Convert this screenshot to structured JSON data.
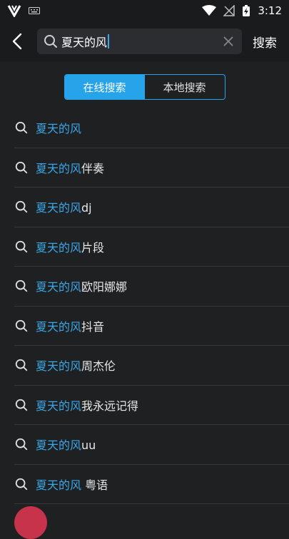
{
  "status_bar": {
    "time": "3:12",
    "icons": [
      "app-v-icon",
      "keyboard-icon",
      "wifi-icon",
      "no-signal-icon",
      "battery-charging-icon"
    ]
  },
  "header": {
    "search_value": "夏天的风",
    "submit_label": "搜索"
  },
  "mode_tabs": [
    {
      "label": "在线搜索",
      "active": true
    },
    {
      "label": "本地搜索",
      "active": false
    }
  ],
  "suggestions": [
    {
      "match": "夏天的风",
      "suffix": ""
    },
    {
      "match": "夏天的风",
      "suffix": "伴奏"
    },
    {
      "match": "夏天的风",
      "suffix": "dj"
    },
    {
      "match": "夏天的风",
      "suffix": "片段"
    },
    {
      "match": "夏天的风",
      "suffix": "欧阳娜娜"
    },
    {
      "match": "夏天的风",
      "suffix": "抖音"
    },
    {
      "match": "夏天的风",
      "suffix": "周杰伦"
    },
    {
      "match": "夏天的风",
      "suffix": "我永远记得"
    },
    {
      "match": "夏天的风",
      "suffix": "uu"
    },
    {
      "match": "夏天的风",
      "suffix": " 粤语"
    }
  ],
  "colors": {
    "accent": "#27a3ea",
    "highlight_text": "#3aa7e8",
    "background": "#1f2022"
  }
}
